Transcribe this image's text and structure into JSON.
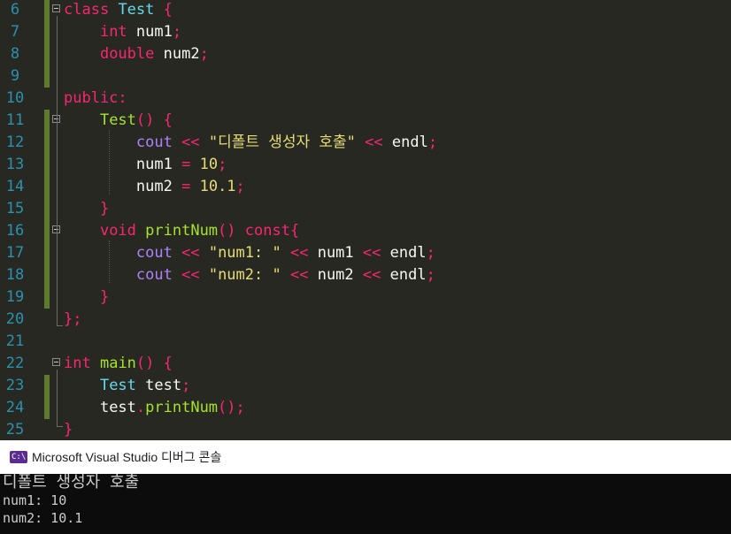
{
  "editor": {
    "lines": [
      {
        "num": "6",
        "segs": [
          [
            "kw",
            "class"
          ],
          [
            "pn",
            " "
          ],
          [
            "ty",
            "Test"
          ],
          [
            "pn",
            " "
          ],
          [
            "kw",
            "{"
          ]
        ]
      },
      {
        "num": "7",
        "segs": [
          [
            "pn",
            "    "
          ],
          [
            "kw",
            "int"
          ],
          [
            "pn",
            " "
          ],
          [
            "vr",
            "num1"
          ],
          [
            "kw",
            ";"
          ]
        ]
      },
      {
        "num": "8",
        "segs": [
          [
            "pn",
            "    "
          ],
          [
            "kw",
            "double"
          ],
          [
            "pn",
            " "
          ],
          [
            "vr",
            "num2"
          ],
          [
            "kw",
            ";"
          ]
        ]
      },
      {
        "num": "9",
        "segs": []
      },
      {
        "num": "10",
        "segs": [
          [
            "kw",
            "public:"
          ]
        ]
      },
      {
        "num": "11",
        "segs": [
          [
            "pn",
            "    "
          ],
          [
            "fn",
            "Test"
          ],
          [
            "kw",
            "()"
          ],
          [
            "pn",
            " "
          ],
          [
            "kw",
            "{"
          ]
        ]
      },
      {
        "num": "12",
        "segs": [
          [
            "pn",
            "        "
          ],
          [
            "io",
            "cout"
          ],
          [
            "pn",
            " "
          ],
          [
            "op",
            "<<"
          ],
          [
            "pn",
            " "
          ],
          [
            "st",
            "\"디폴트 생성자 호출\""
          ],
          [
            "pn",
            " "
          ],
          [
            "op",
            "<<"
          ],
          [
            "pn",
            " "
          ],
          [
            "vr",
            "endl"
          ],
          [
            "kw",
            ";"
          ]
        ]
      },
      {
        "num": "13",
        "segs": [
          [
            "pn",
            "        "
          ],
          [
            "vr",
            "num1"
          ],
          [
            "pn",
            " "
          ],
          [
            "op",
            "="
          ],
          [
            "pn",
            " "
          ],
          [
            "nm",
            "10"
          ],
          [
            "kw",
            ";"
          ]
        ]
      },
      {
        "num": "14",
        "segs": [
          [
            "pn",
            "        "
          ],
          [
            "vr",
            "num2"
          ],
          [
            "pn",
            " "
          ],
          [
            "op",
            "="
          ],
          [
            "pn",
            " "
          ],
          [
            "nm",
            "10.1"
          ],
          [
            "kw",
            ";"
          ]
        ]
      },
      {
        "num": "15",
        "segs": [
          [
            "pn",
            "    "
          ],
          [
            "kw",
            "}"
          ]
        ]
      },
      {
        "num": "16",
        "segs": [
          [
            "pn",
            "    "
          ],
          [
            "kw",
            "void"
          ],
          [
            "pn",
            " "
          ],
          [
            "fn",
            "printNum"
          ],
          [
            "kw",
            "()"
          ],
          [
            "pn",
            " "
          ],
          [
            "kw",
            "const{"
          ]
        ]
      },
      {
        "num": "17",
        "segs": [
          [
            "pn",
            "        "
          ],
          [
            "io",
            "cout"
          ],
          [
            "pn",
            " "
          ],
          [
            "op",
            "<<"
          ],
          [
            "pn",
            " "
          ],
          [
            "st",
            "\"num1: \""
          ],
          [
            "pn",
            " "
          ],
          [
            "op",
            "<<"
          ],
          [
            "pn",
            " "
          ],
          [
            "vr",
            "num1"
          ],
          [
            "pn",
            " "
          ],
          [
            "op",
            "<<"
          ],
          [
            "pn",
            " "
          ],
          [
            "vr",
            "endl"
          ],
          [
            "kw",
            ";"
          ]
        ]
      },
      {
        "num": "18",
        "segs": [
          [
            "pn",
            "        "
          ],
          [
            "io",
            "cout"
          ],
          [
            "pn",
            " "
          ],
          [
            "op",
            "<<"
          ],
          [
            "pn",
            " "
          ],
          [
            "st",
            "\"num2: \""
          ],
          [
            "pn",
            " "
          ],
          [
            "op",
            "<<"
          ],
          [
            "pn",
            " "
          ],
          [
            "vr",
            "num2"
          ],
          [
            "pn",
            " "
          ],
          [
            "op",
            "<<"
          ],
          [
            "pn",
            " "
          ],
          [
            "vr",
            "endl"
          ],
          [
            "kw",
            ";"
          ]
        ]
      },
      {
        "num": "19",
        "segs": [
          [
            "pn",
            "    "
          ],
          [
            "kw",
            "}"
          ]
        ]
      },
      {
        "num": "20",
        "segs": [
          [
            "kw",
            "};"
          ]
        ]
      },
      {
        "num": "21",
        "segs": []
      },
      {
        "num": "22",
        "segs": [
          [
            "kw",
            "int"
          ],
          [
            "pn",
            " "
          ],
          [
            "fn",
            "main"
          ],
          [
            "kw",
            "()"
          ],
          [
            "pn",
            " "
          ],
          [
            "kw",
            "{"
          ]
        ]
      },
      {
        "num": "23",
        "segs": [
          [
            "pn",
            "    "
          ],
          [
            "ty",
            "Test"
          ],
          [
            "pn",
            " "
          ],
          [
            "vr",
            "test"
          ],
          [
            "kw",
            ";"
          ]
        ]
      },
      {
        "num": "24",
        "segs": [
          [
            "pn",
            "    "
          ],
          [
            "vr",
            "test"
          ],
          [
            "kw",
            "."
          ],
          [
            "fn",
            "printNum"
          ],
          [
            "kw",
            "();"
          ]
        ]
      },
      {
        "num": "25",
        "segs": [
          [
            "kw",
            "}"
          ]
        ]
      }
    ]
  },
  "console": {
    "icon_label": "C:\\",
    "title": "Microsoft Visual Studio 디버그 콘솔",
    "output": [
      "디폴트 생성자 호출",
      "num1: 10",
      "num2: 10.1"
    ]
  },
  "colors": {
    "editor_bg": "#272822",
    "keyword": "#f92672",
    "type": "#66d9ef",
    "function": "#a6e22e",
    "string": "#e6db74",
    "stream": "#ae81ff",
    "change_marker": "#5d7a2f",
    "line_number": "#2b91af"
  }
}
